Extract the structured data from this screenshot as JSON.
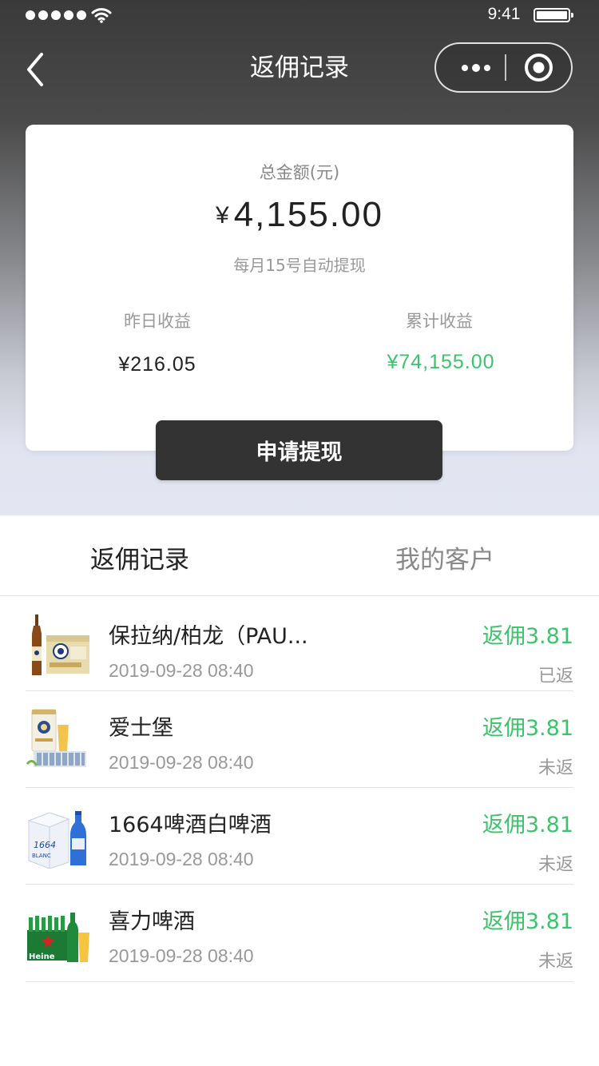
{
  "status_bar": {
    "time": "9:41"
  },
  "nav": {
    "title": "返佣记录"
  },
  "summary": {
    "total_label": "总金额(元)",
    "currency": "¥",
    "total_amount": "4,155.00",
    "note": "每月15号自动提现",
    "yesterday_label": "昨日收益",
    "yesterday_value": "¥216.05",
    "cumulative_label": "累计收益",
    "cumulative_value": "¥74,155.00",
    "accent_color": "#3cc36b"
  },
  "withdraw_button": {
    "label": "申请提现"
  },
  "tabs": [
    {
      "label": "返佣记录",
      "active": true
    },
    {
      "label": "我的客户",
      "active": false
    }
  ],
  "records": [
    {
      "name": "保拉纳/柏龙（PAU...",
      "date": "2019-09-28 08:40",
      "commission": "返佣3.81",
      "status": "已返",
      "icon": "paulaner-beer-product-image"
    },
    {
      "name": "爱士堡",
      "date": "2019-09-28 08:40",
      "commission": "返佣3.81",
      "status": "未返",
      "icon": "eichbaum-beer-product-image"
    },
    {
      "name": "1664啤酒白啤酒",
      "date": "2019-09-28 08:40",
      "commission": "返佣3.81",
      "status": "未返",
      "icon": "kronenbourg-1664-blanc-product-image"
    },
    {
      "name": "喜力啤酒",
      "date": "2019-09-28 08:40",
      "commission": "返佣3.81",
      "status": "未返",
      "icon": "heineken-beer-product-image"
    }
  ]
}
